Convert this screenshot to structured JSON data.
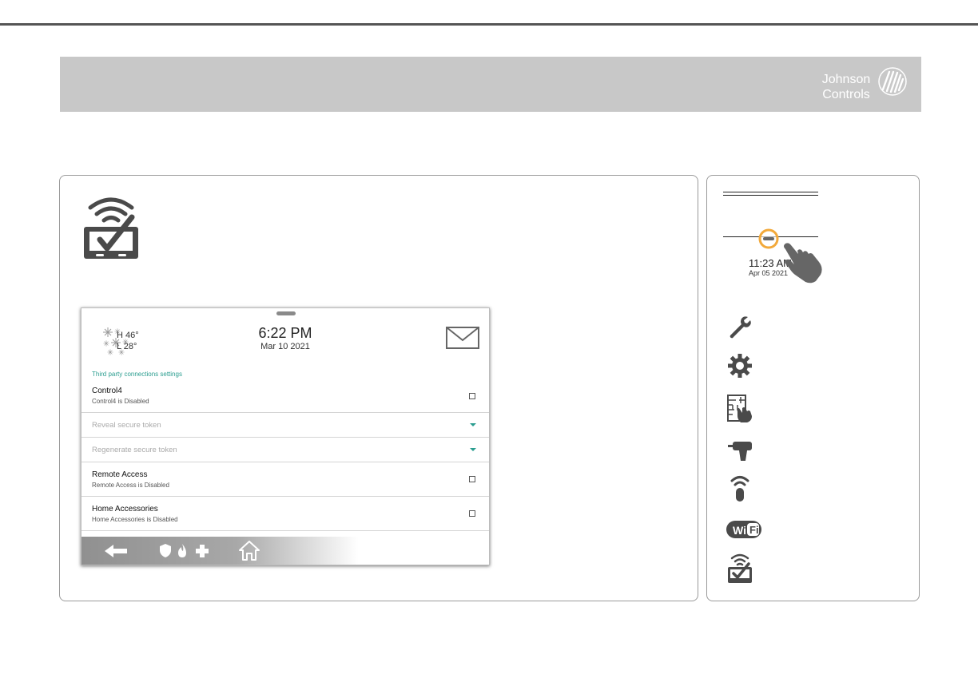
{
  "brand": {
    "name_line1": "Johnson",
    "name_line2": "Controls"
  },
  "colors": {
    "header_band": "#c8c8c8",
    "accent_teal": "#2a9d8f",
    "highlight_orange": "#f2a93b",
    "icon_gray": "#4a4a4a"
  },
  "main_panel": {
    "icon": "connected-panel-checkmark-icon",
    "screen": {
      "weather": {
        "icon": "snowflake-icon",
        "high": "H 46°",
        "low": "L 28°"
      },
      "clock": {
        "time": "6:22 PM",
        "date": "Mar 10 2021"
      },
      "messages_icon": "envelope-icon",
      "section_title": "Third party connections settings",
      "settings": [
        {
          "title": "Control4",
          "subtitle": "Control4 is Disabled",
          "control": "checkbox",
          "checked": false,
          "enabled": true
        },
        {
          "title": "Reveal secure token",
          "control": "dropdown",
          "enabled": false
        },
        {
          "title": "Regenerate secure token",
          "control": "dropdown",
          "enabled": false
        },
        {
          "title": "Remote Access",
          "subtitle": "Remote Access is Disabled",
          "control": "checkbox",
          "checked": false,
          "enabled": true
        },
        {
          "title": "Home Accessories",
          "subtitle": "Home Accessories is Disabled",
          "control": "checkbox",
          "checked": false,
          "enabled": true
        }
      ],
      "navbar_icons": [
        "back-arrow-icon",
        "shield-icon",
        "fire-icon",
        "plus-icon",
        "home-icon"
      ]
    }
  },
  "side_panel": {
    "clock": {
      "time": "11:23 AM",
      "date": "Apr 05 2021"
    },
    "menu_icons": [
      "wrench-icon",
      "gear-icon",
      "installation-icon",
      "drill-icon",
      "sensor-icon",
      "wifi-icon",
      "connected-panel-checkmark-icon"
    ]
  }
}
